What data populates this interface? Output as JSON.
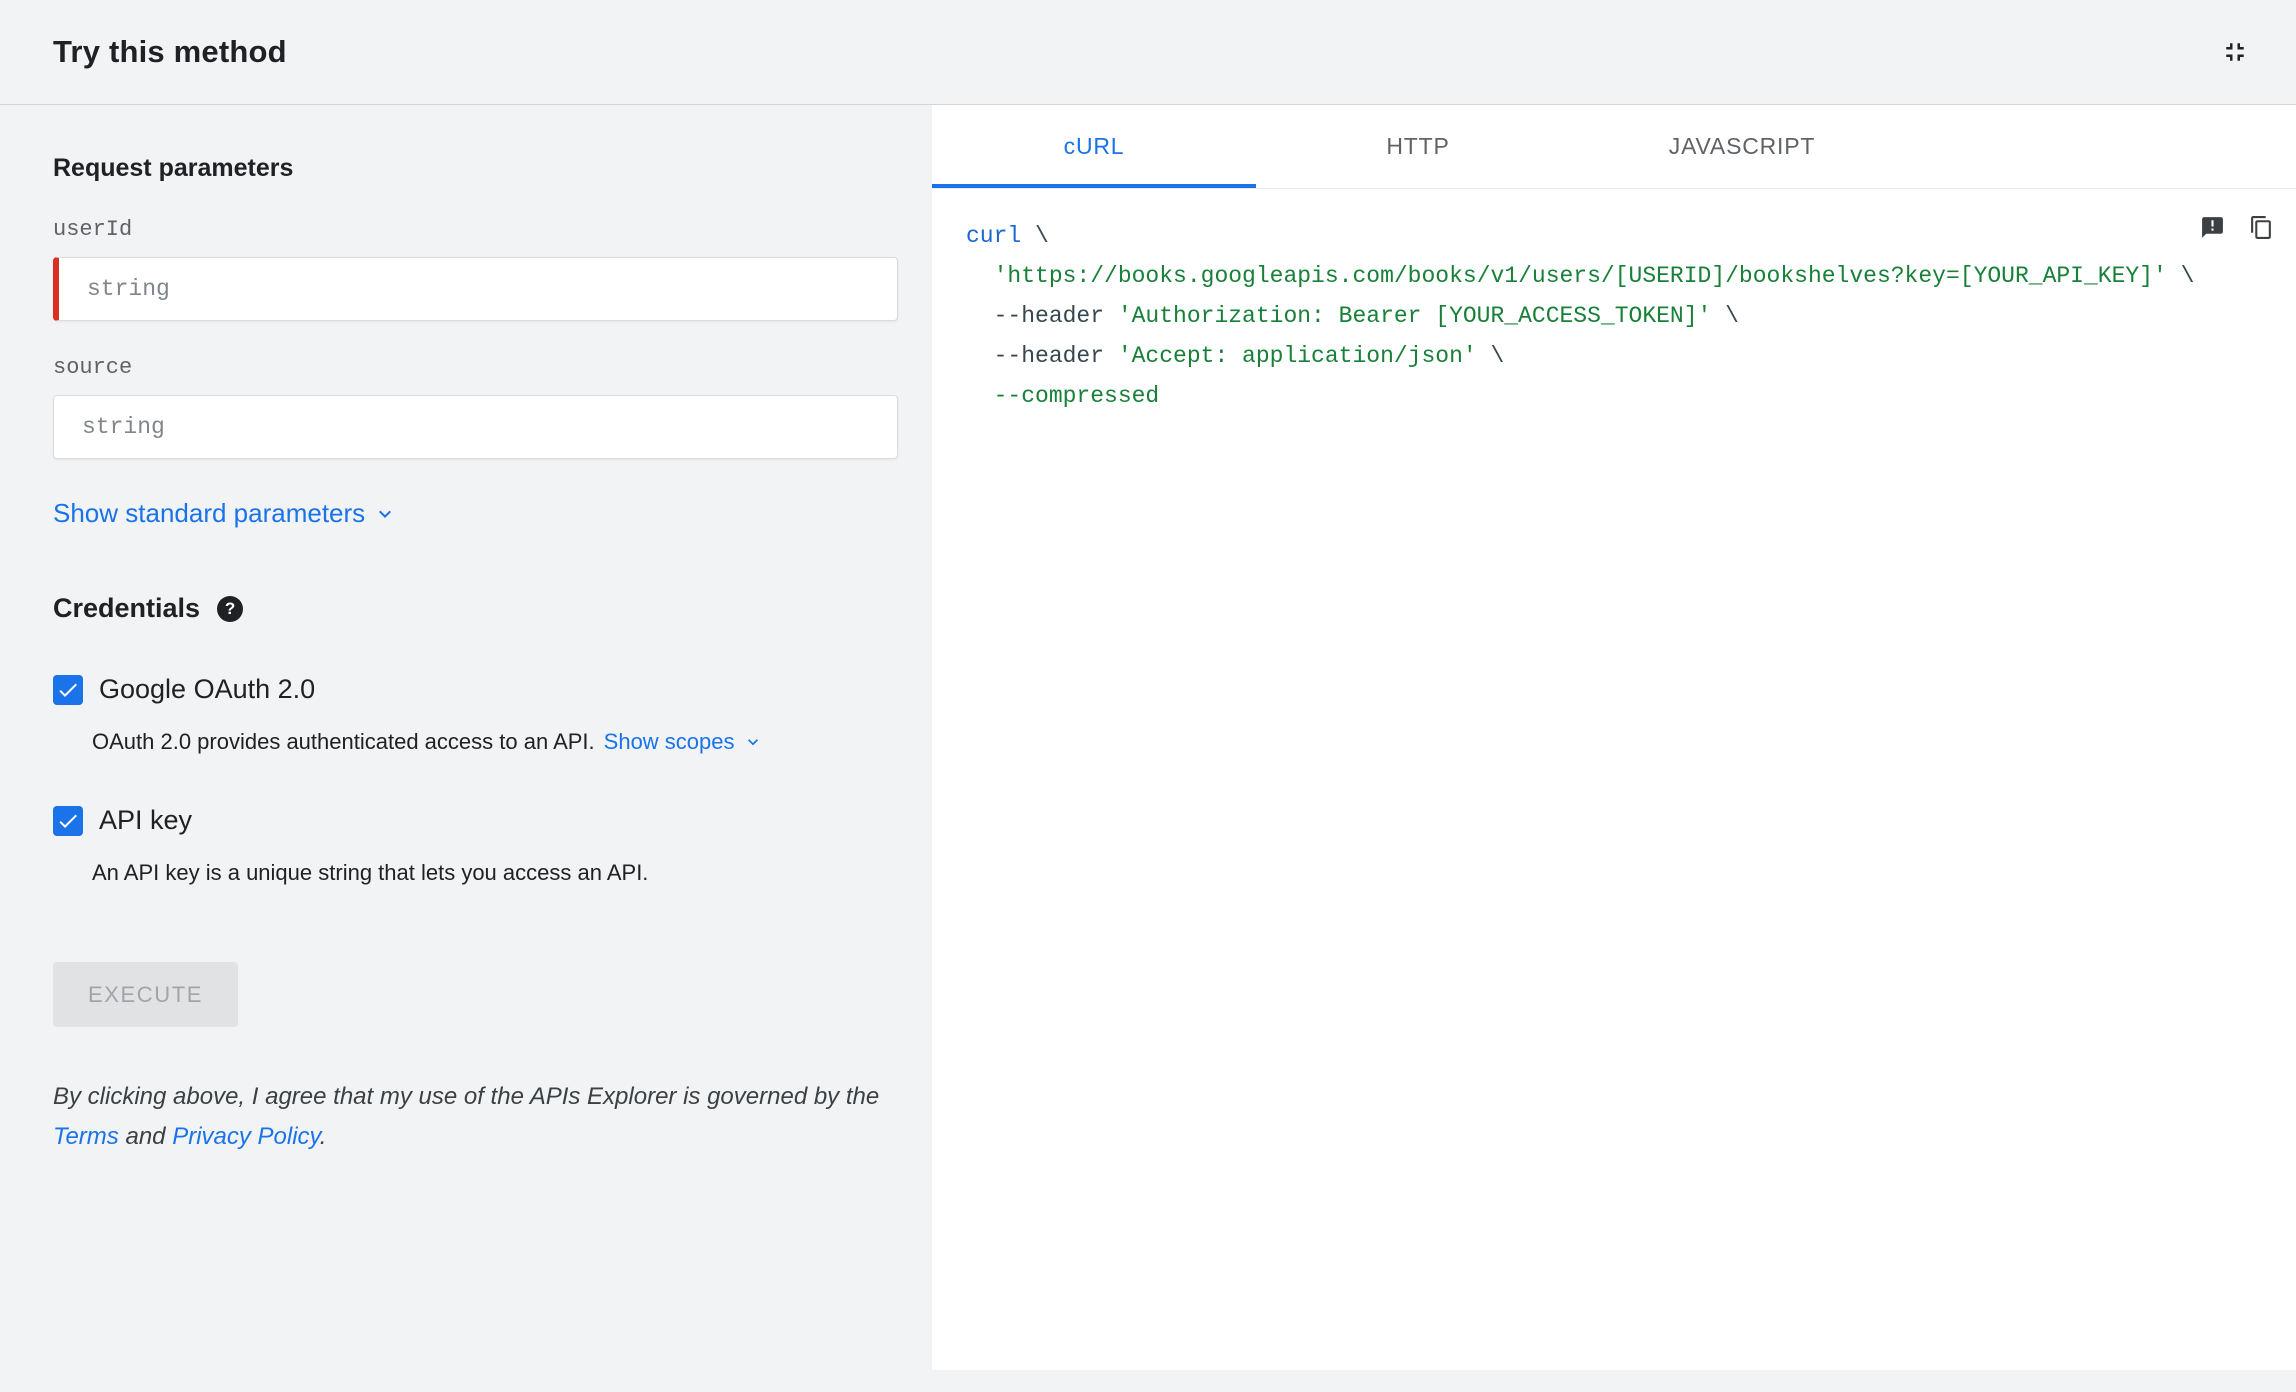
{
  "header": {
    "title": "Try this method"
  },
  "left": {
    "request_title": "Request parameters",
    "params": [
      {
        "name": "userId",
        "placeholder": "string",
        "required": true
      },
      {
        "name": "source",
        "placeholder": "string",
        "required": false
      }
    ],
    "show_standard_link": "Show standard parameters",
    "credentials_title": "Credentials",
    "help_glyph": "?",
    "oauth_label": "Google OAuth 2.0",
    "oauth_desc": "OAuth 2.0 provides authenticated access to an API.",
    "show_scopes_link": "Show scopes",
    "apikey_label": "API key",
    "apikey_desc": "An API key is a unique string that lets you access an API.",
    "execute_label": "EXECUTE",
    "disclaimer": {
      "text_before": "By clicking above, I agree that my use of the APIs Explorer is governed by the ",
      "terms_link": "Terms",
      "text_mid": " and ",
      "privacy_link": "Privacy Policy",
      "text_after": "."
    }
  },
  "tabs": [
    {
      "label": "cURL",
      "active": true
    },
    {
      "label": "HTTP",
      "active": false
    },
    {
      "label": "JAVASCRIPT",
      "active": false
    }
  ],
  "code": {
    "lines": [
      {
        "tokens": [
          {
            "t": "curl",
            "c": "kw"
          },
          {
            "t": " \\",
            "c": "p"
          }
        ]
      },
      {
        "tokens": [
          {
            "t": "  ",
            "c": "p"
          },
          {
            "t": "'https://books.googleapis.com/books/v1/users/[USERID]/bookshelves?key=[YOUR_API_KEY]'",
            "c": "s"
          },
          {
            "t": " \\",
            "c": "p"
          }
        ]
      },
      {
        "tokens": [
          {
            "t": "  --header ",
            "c": "p"
          },
          {
            "t": "'Authorization: Bearer [YOUR_ACCESS_TOKEN]'",
            "c": "s"
          },
          {
            "t": " \\",
            "c": "p"
          }
        ]
      },
      {
        "tokens": [
          {
            "t": "  --header ",
            "c": "p"
          },
          {
            "t": "'Accept: application/json'",
            "c": "s"
          },
          {
            "t": " \\",
            "c": "p"
          }
        ]
      },
      {
        "tokens": [
          {
            "t": "  --compressed",
            "c": "s"
          }
        ]
      }
    ]
  },
  "colors": {
    "accent_blue": "#1a73e8",
    "required_red": "#d93025",
    "tab_inactive": "#5f6368",
    "code_keyword": "#1967d2",
    "code_string": "#188038",
    "code_plain": "#37474f"
  }
}
